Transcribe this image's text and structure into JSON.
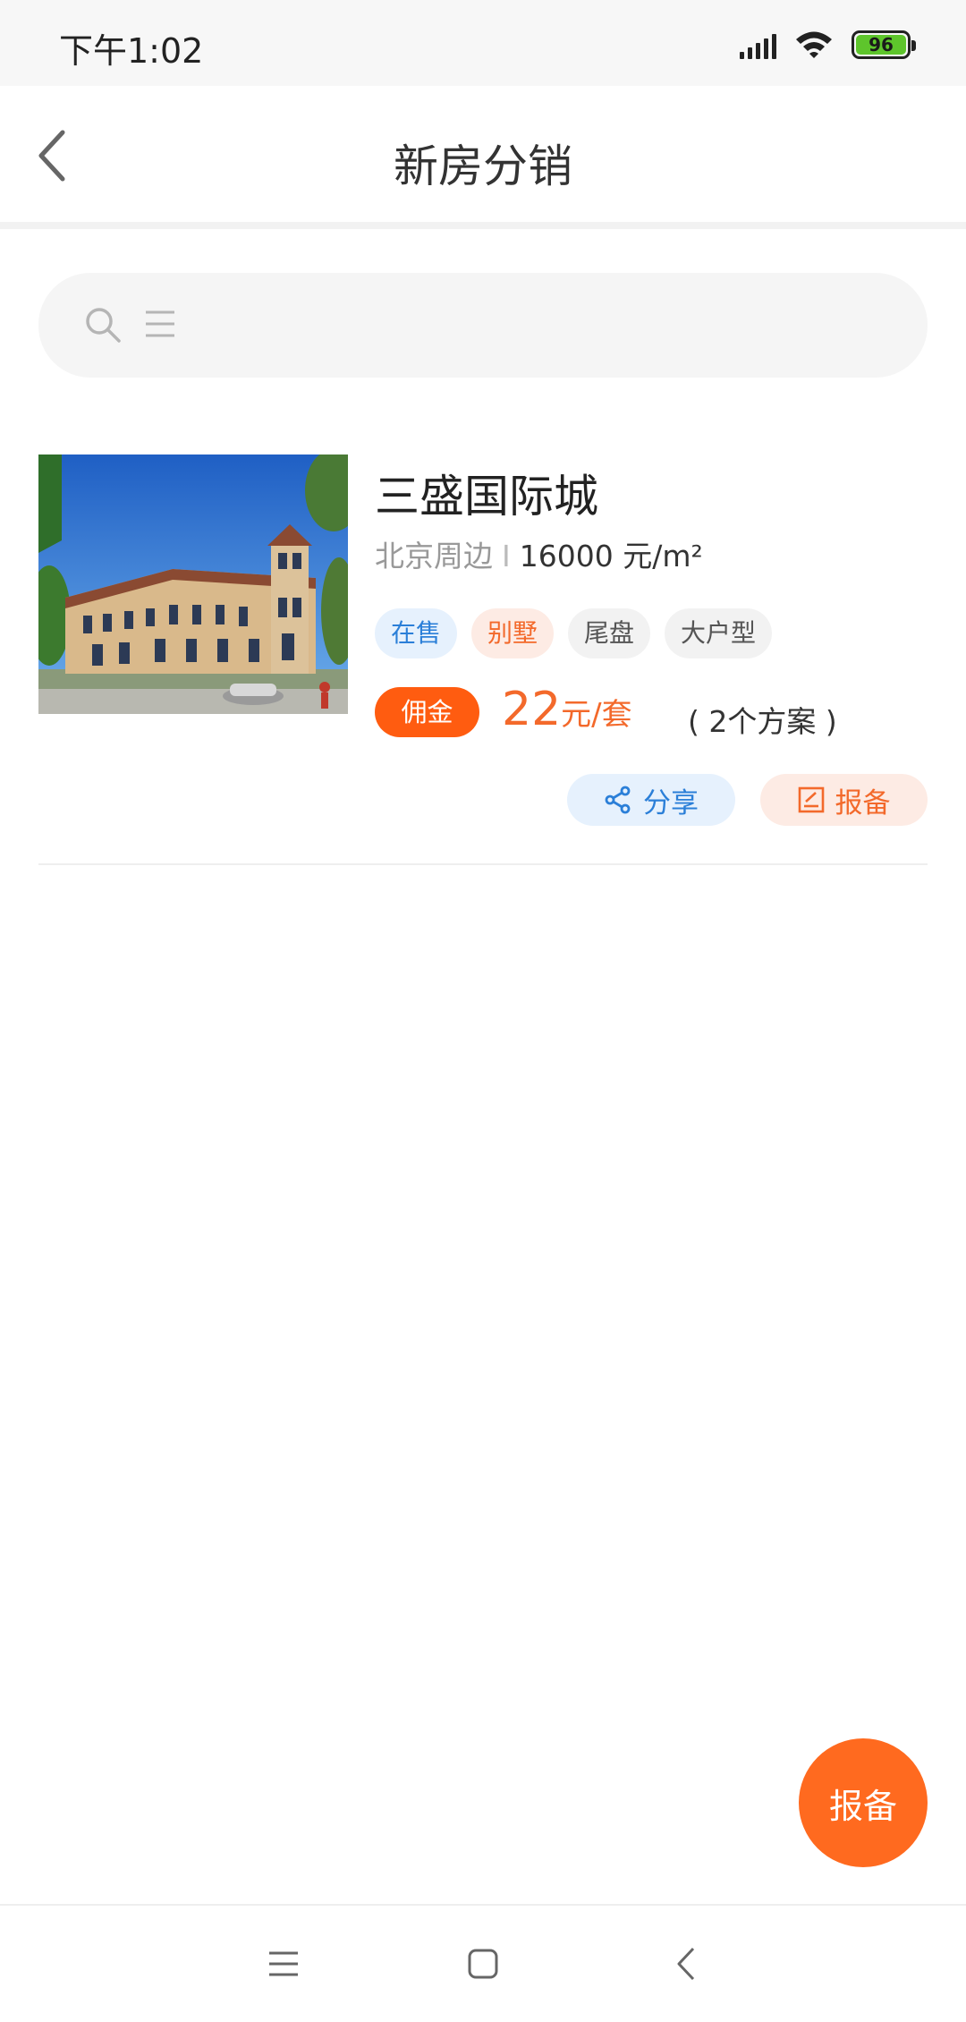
{
  "status_bar": {
    "time": "下午1:02",
    "battery": "96"
  },
  "header": {
    "title": "新房分销"
  },
  "listing": {
    "name": "三盛国际城",
    "location": "北京周边",
    "separator": "I",
    "price": "16000 元/m²",
    "tags": [
      "在售",
      "别墅",
      "尾盘",
      "大户型"
    ],
    "commission_label": "佣金",
    "commission_value": "22",
    "commission_unit": "元/套",
    "plans": "( 2个方案 )",
    "share_label": "分享",
    "report_label": "报备"
  },
  "fab": {
    "label": "报备"
  },
  "colors": {
    "accent_orange": "#ff5c10",
    "accent_blue": "#2b7fd8",
    "battery_green": "#5ec52c"
  },
  "icons": {
    "back": "chevron-left-icon",
    "search": "search-icon",
    "menu": "menu-lines-icon",
    "share": "share-icon",
    "report": "edit-note-icon",
    "nav_menu": "nav-menu-icon",
    "nav_home": "nav-home-icon",
    "nav_back": "nav-back-icon"
  }
}
